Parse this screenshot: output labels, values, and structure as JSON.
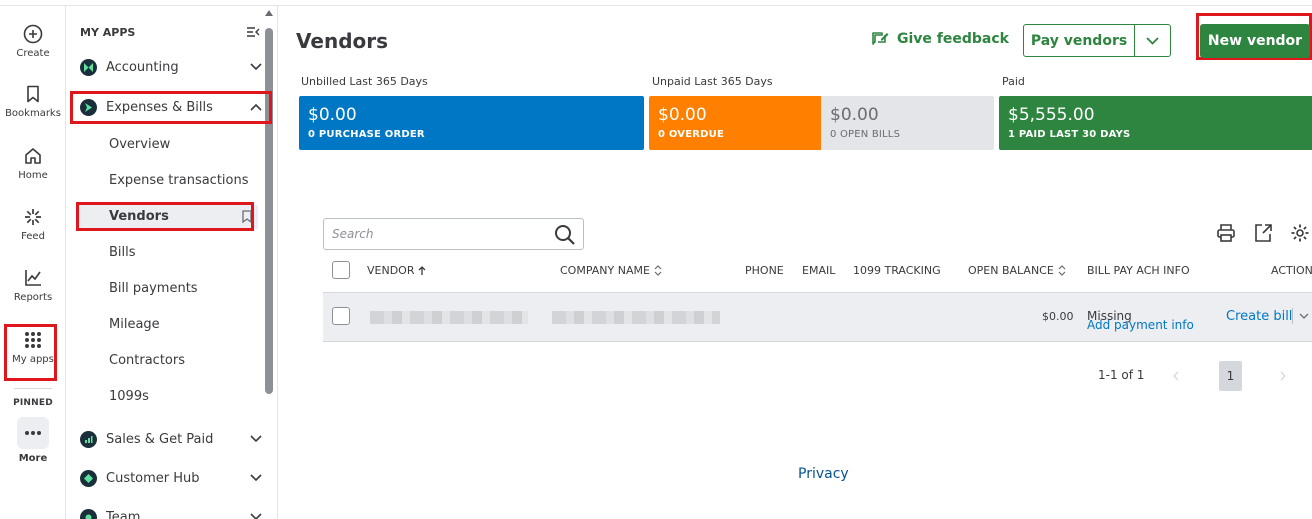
{
  "rail": {
    "items": [
      {
        "label": "Create",
        "icon": "plus-circle-icon"
      },
      {
        "label": "Bookmarks",
        "icon": "bookmark-icon"
      },
      {
        "label": "Home",
        "icon": "home-icon"
      },
      {
        "label": "Feed",
        "icon": "feed-icon"
      },
      {
        "label": "Reports",
        "icon": "reports-icon"
      },
      {
        "label": "My apps",
        "icon": "apps-grid-icon"
      }
    ],
    "pinned_label": "PINNED",
    "more_label": "More"
  },
  "panel": {
    "heading": "MY APPS",
    "apps": [
      {
        "label": "Accounting",
        "color": "#1b2f3a"
      },
      {
        "label": "Expenses & Bills",
        "color": "#1b2f3a"
      },
      {
        "label": "Sales & Get Paid",
        "color": "#1b2f3a"
      },
      {
        "label": "Customer Hub",
        "color": "#1b2f3a"
      },
      {
        "label": "Team",
        "color": "#1b2f3a"
      }
    ],
    "sub_items": [
      "Overview",
      "Expense transactions",
      "Vendors",
      "Bills",
      "Bill payments",
      "Mileage",
      "Contractors",
      "1099s"
    ],
    "active_sub": "Vendors"
  },
  "header": {
    "title": "Vendors",
    "feedback_label": "Give feedback",
    "pay_vendors_label": "Pay vendors",
    "new_vendor_label": "New vendor"
  },
  "summary": {
    "unbilled_head": "Unbilled Last 365 Days",
    "unpaid_head": "Unpaid Last 365 Days",
    "paid_head": "Paid",
    "tiles": [
      {
        "amount": "$0.00",
        "sub": "0  PURCHASE ORDER",
        "color": "#0077c5"
      },
      {
        "amount": "$0.00",
        "sub": "0  OVERDUE",
        "color": "#ff8000"
      },
      {
        "amount": "$0.00",
        "sub": "0  OPEN BILLS",
        "color": "#e3e5e8"
      },
      {
        "amount": "$5,555.00",
        "sub": "1  PAID LAST 30 DAYS",
        "color": "#2e8540"
      }
    ]
  },
  "table": {
    "search_placeholder": "Search",
    "columns": {
      "vendor": "VENDOR",
      "company": "COMPANY NAME",
      "phone": "PHONE",
      "email": "EMAIL",
      "tracking": "1099 TRACKING",
      "balance": "OPEN BALANCE",
      "ach": "BILL PAY ACH INFO",
      "action": "ACTION"
    },
    "rows": [
      {
        "open_balance": "$0.00",
        "ach_status": "Missing",
        "ach_link": "Add payment info",
        "action": "Create bill"
      }
    ],
    "pagination": {
      "range": "1-1 of 1",
      "page": "1"
    }
  },
  "footer": {
    "privacy": "Privacy"
  },
  "colors": {
    "accent_green": "#2e8540",
    "highlight_red": "#e0161d",
    "link_blue": "#0077c5"
  }
}
